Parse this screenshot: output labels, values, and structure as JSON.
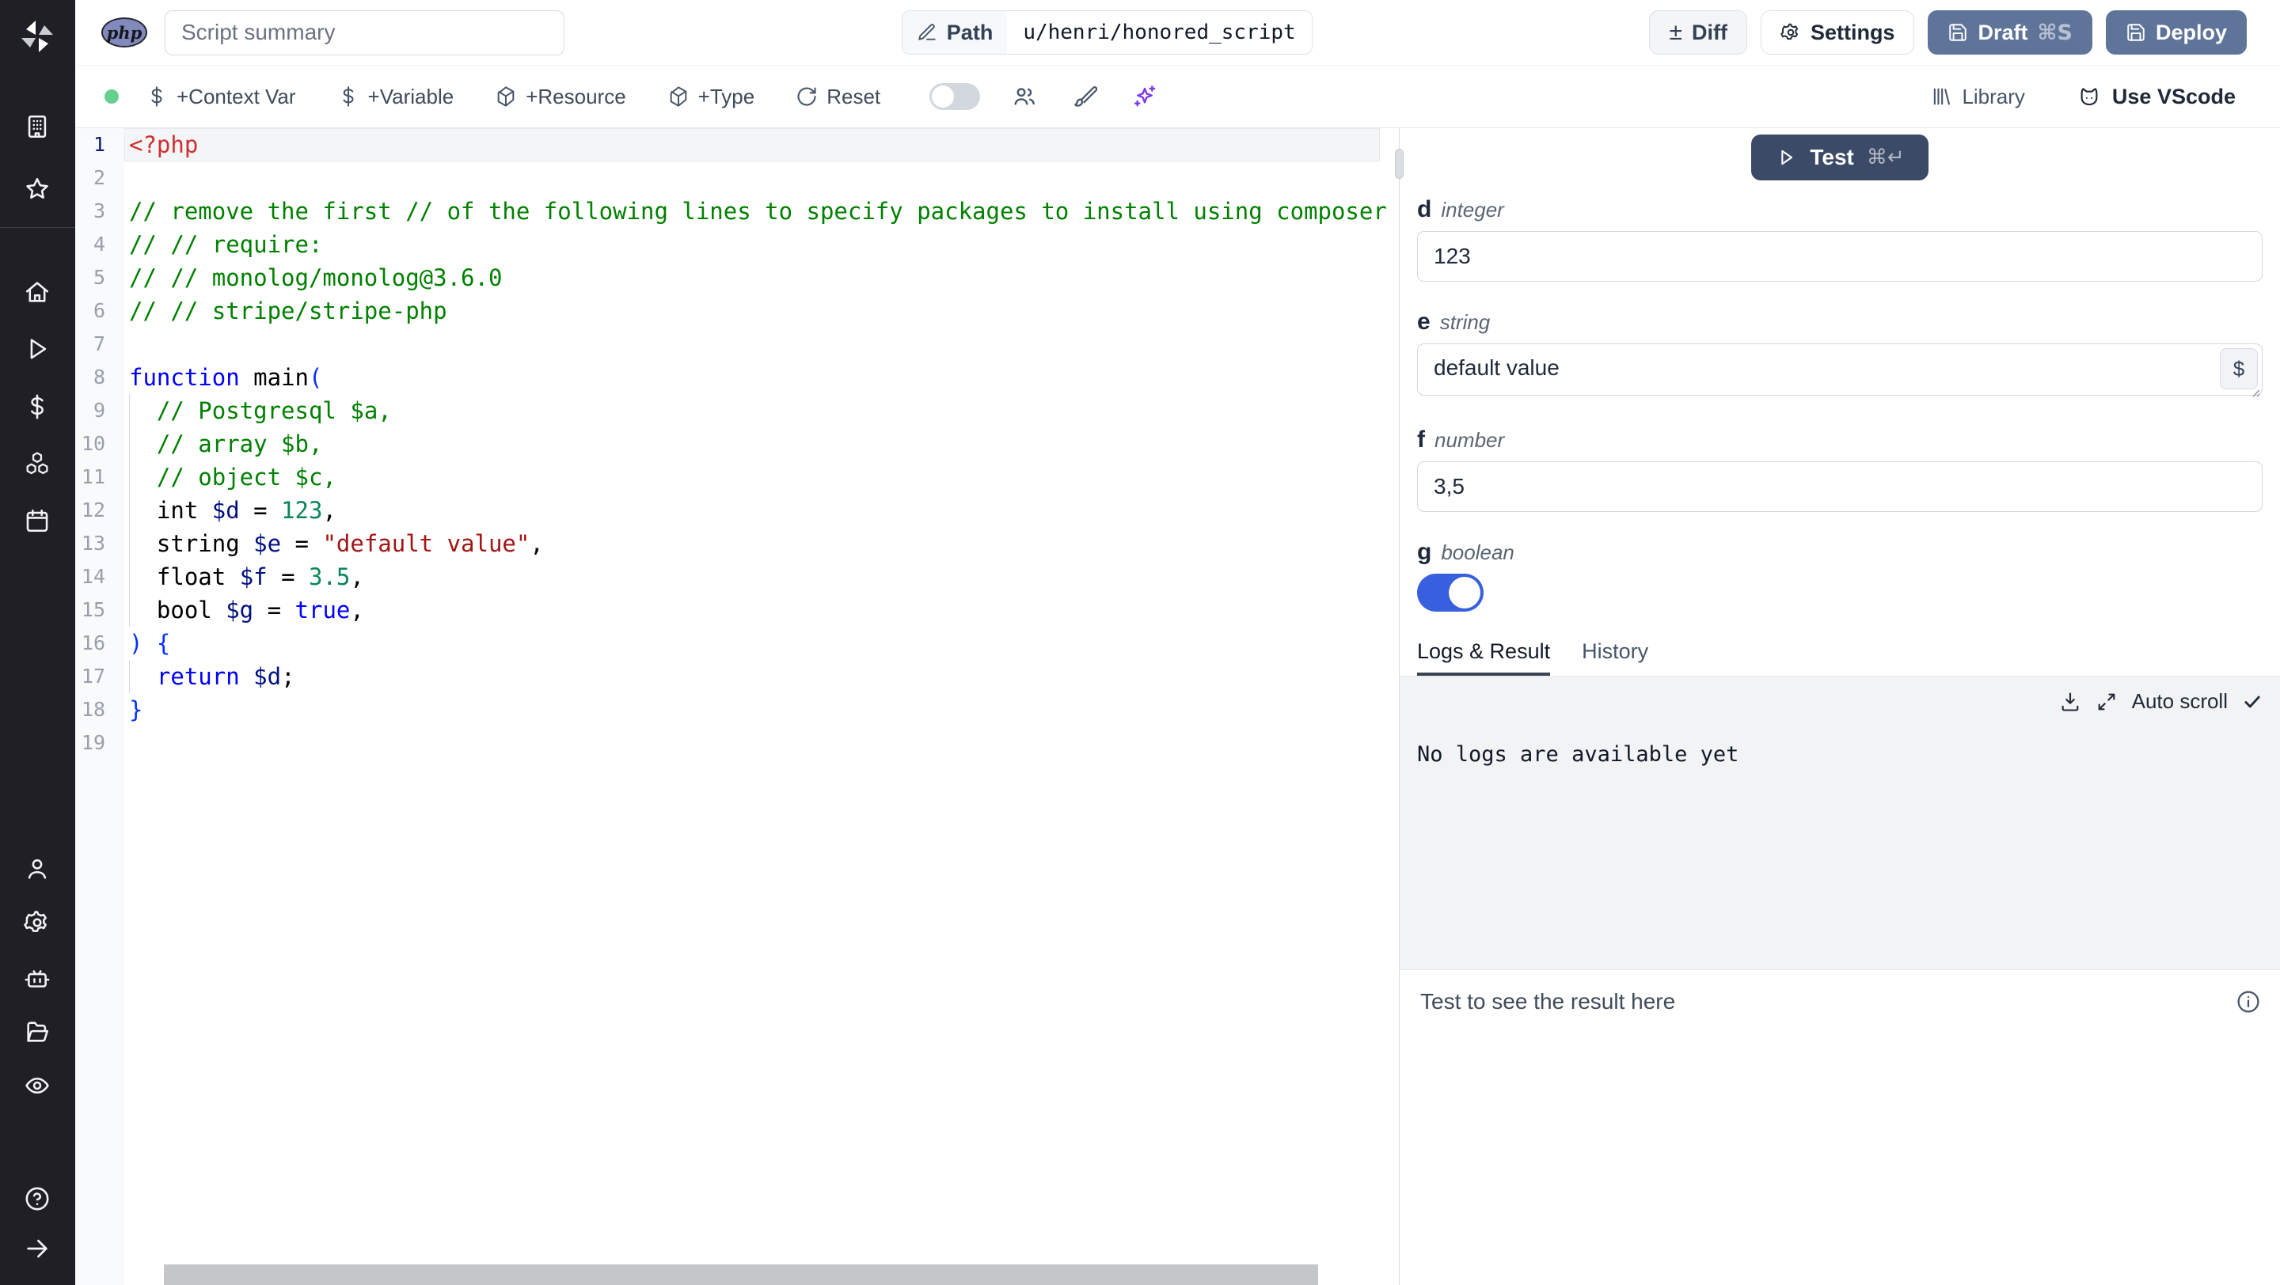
{
  "colors": {
    "sidebar_bg": "#211f26",
    "status_dot": "#65cf8d",
    "accent_button": "#5f7499",
    "test_button": "#3b4a66",
    "toggle_on": "#3860de",
    "ai_sparkle": "#7c3aed"
  },
  "header": {
    "language_badge": "php",
    "summary_placeholder": "Script summary",
    "path_label": "Path",
    "path_value": "u/henri/honored_script",
    "diff_label": "Diff",
    "settings_label": "Settings",
    "draft_label": "Draft",
    "draft_shortcut": "⌘S",
    "deploy_label": "Deploy"
  },
  "toolbar": {
    "items": [
      {
        "label": "+Context Var",
        "icon": "dollar"
      },
      {
        "label": "+Variable",
        "icon": "dollar"
      },
      {
        "label": "+Resource",
        "icon": "package"
      },
      {
        "label": "+Type",
        "icon": "package"
      },
      {
        "label": "Reset",
        "icon": "reset"
      }
    ],
    "library_label": "Library",
    "vscode_label": "Use VScode"
  },
  "editor": {
    "syntax_colors": {
      "tag": "#cd3131",
      "comment": "#008000",
      "keyword": "#0000ff",
      "variable": "#001080",
      "number": "#098658",
      "string": "#a31515",
      "bracket": "#0431fa",
      "plain": "#000000"
    },
    "lines": [
      {
        "n": 1,
        "active": true,
        "segments": [
          {
            "t": "<?php",
            "c": "tag"
          }
        ]
      },
      {
        "n": 2,
        "segments": []
      },
      {
        "n": 3,
        "segments": [
          {
            "t": "// remove the first // of the following lines to specify packages to install using composer",
            "c": "comment"
          }
        ]
      },
      {
        "n": 4,
        "segments": [
          {
            "t": "// // require:",
            "c": "comment"
          }
        ]
      },
      {
        "n": 5,
        "segments": [
          {
            "t": "// // monolog/monolog@3.6.0",
            "c": "comment"
          }
        ]
      },
      {
        "n": 6,
        "segments": [
          {
            "t": "// // stripe/stripe-php",
            "c": "comment"
          }
        ]
      },
      {
        "n": 7,
        "segments": []
      },
      {
        "n": 8,
        "segments": [
          {
            "t": "function",
            "c": "keyword"
          },
          {
            "t": " main",
            "c": "plain"
          },
          {
            "t": "(",
            "c": "bracket"
          }
        ]
      },
      {
        "n": 9,
        "guide": true,
        "segments": [
          {
            "t": "  ",
            "c": "plain"
          },
          {
            "t": "// Postgresql $a,",
            "c": "comment"
          }
        ]
      },
      {
        "n": 10,
        "guide": true,
        "segments": [
          {
            "t": "  ",
            "c": "plain"
          },
          {
            "t": "// array $b,",
            "c": "comment"
          }
        ]
      },
      {
        "n": 11,
        "guide": true,
        "segments": [
          {
            "t": "  ",
            "c": "plain"
          },
          {
            "t": "// object $c,",
            "c": "comment"
          }
        ]
      },
      {
        "n": 12,
        "guide": true,
        "segments": [
          {
            "t": "  int ",
            "c": "plain"
          },
          {
            "t": "$d",
            "c": "variable"
          },
          {
            "t": " = ",
            "c": "plain"
          },
          {
            "t": "123",
            "c": "number"
          },
          {
            "t": ",",
            "c": "plain"
          }
        ]
      },
      {
        "n": 13,
        "guide": true,
        "segments": [
          {
            "t": "  string ",
            "c": "plain"
          },
          {
            "t": "$e",
            "c": "variable"
          },
          {
            "t": " = ",
            "c": "plain"
          },
          {
            "t": "\"default value\"",
            "c": "string"
          },
          {
            "t": ",",
            "c": "plain"
          }
        ]
      },
      {
        "n": 14,
        "guide": true,
        "segments": [
          {
            "t": "  float ",
            "c": "plain"
          },
          {
            "t": "$f",
            "c": "variable"
          },
          {
            "t": " = ",
            "c": "plain"
          },
          {
            "t": "3.5",
            "c": "number"
          },
          {
            "t": ",",
            "c": "plain"
          }
        ]
      },
      {
        "n": 15,
        "guide": true,
        "segments": [
          {
            "t": "  bool ",
            "c": "plain"
          },
          {
            "t": "$g",
            "c": "variable"
          },
          {
            "t": " = ",
            "c": "plain"
          },
          {
            "t": "true",
            "c": "keyword"
          },
          {
            "t": ",",
            "c": "plain"
          }
        ]
      },
      {
        "n": 16,
        "segments": [
          {
            "t": ") {",
            "c": "bracket"
          }
        ]
      },
      {
        "n": 17,
        "guide": true,
        "segments": [
          {
            "t": "  ",
            "c": "plain"
          },
          {
            "t": "return",
            "c": "keyword"
          },
          {
            "t": " ",
            "c": "plain"
          },
          {
            "t": "$d",
            "c": "variable"
          },
          {
            "t": ";",
            "c": "plain"
          }
        ]
      },
      {
        "n": 18,
        "segments": [
          {
            "t": "}",
            "c": "bracket"
          }
        ]
      },
      {
        "n": 19,
        "segments": []
      }
    ]
  },
  "right_panel": {
    "test_button": {
      "label": "Test",
      "shortcut": "⌘↵"
    },
    "fields": [
      {
        "name": "d",
        "type": "integer",
        "value": "123"
      },
      {
        "name": "e",
        "type": "string",
        "value": "default value",
        "button": "$"
      },
      {
        "name": "f",
        "type": "number",
        "value": "3,5"
      },
      {
        "name": "g",
        "type": "boolean",
        "value": "on"
      }
    ],
    "tabs": [
      {
        "label": "Logs & Result",
        "active": true
      },
      {
        "label": "History",
        "active": false
      }
    ],
    "logs": {
      "autoscroll_label": "Auto scroll",
      "empty_message": "No logs are available yet"
    },
    "result_placeholder": "Test to see the result here"
  }
}
